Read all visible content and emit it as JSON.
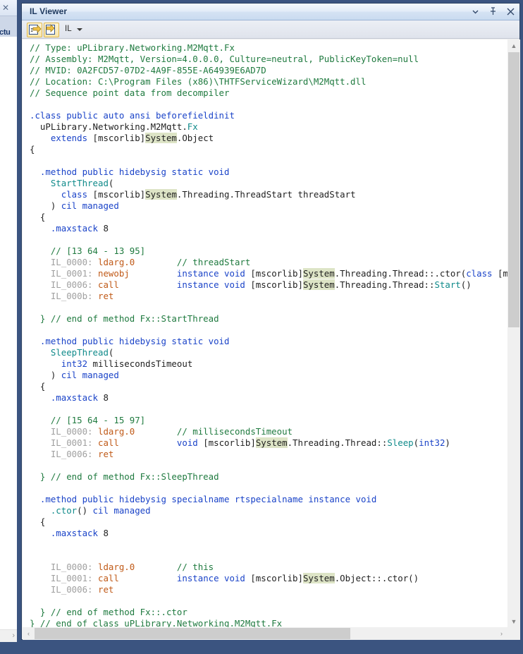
{
  "window": {
    "title": "IL Viewer",
    "buttons": [
      {
        "name": "window-dropdown-button",
        "icon": "chevron-down-icon"
      },
      {
        "name": "window-pin-button",
        "icon": "pin-icon"
      },
      {
        "name": "window-close-button",
        "icon": "close-icon"
      }
    ]
  },
  "background_panel": {
    "close_glyph": "✕",
    "tab_label": "ctu",
    "scroll_arrow": "›"
  },
  "toolbar": {
    "button1_name": "il-navigate-back-button",
    "button2_name": "il-navigate-forward-button",
    "language_label": "IL",
    "language_caret": "caret-down-icon"
  },
  "scrollbars": {
    "vertical": {
      "up": "▲",
      "down": "▼"
    },
    "horizontal": {
      "left": "‹",
      "right": "›"
    }
  },
  "code": {
    "language": "IL",
    "header_comments": [
      "// Type: uPLibrary.Networking.M2Mqtt.Fx",
      "// Assembly: M2Mqtt, Version=4.0.0.0, Culture=neutral, PublicKeyToken=null",
      "// MVID: 0A2FCD57-07D2-4A9F-855E-A64939E6AD7D",
      "// Location: C:\\Program Files (x86)\\THTFServiceWizard\\M2Mqtt.dll",
      "// Sequence point data from decompiler"
    ],
    "lines": [
      [
        {
          "t": "// Type: uPLibrary.Networking.M2Mqtt.Fx",
          "c": "c"
        }
      ],
      [
        {
          "t": "// Assembly: M2Mqtt, Version=4.0.0.0, Culture=neutral, PublicKeyToken=null",
          "c": "c"
        }
      ],
      [
        {
          "t": "// MVID: 0A2FCD57-07D2-4A9F-855E-A64939E6AD7D",
          "c": "c"
        }
      ],
      [
        {
          "t": "// Location: C:\\Program Files (x86)\\THTFServiceWizard\\M2Mqtt.dll",
          "c": "c"
        }
      ],
      [
        {
          "t": "// Sequence point data from decompiler",
          "c": "c"
        }
      ],
      [],
      [
        {
          "t": ".class public auto ansi beforefieldinit",
          "c": "kw"
        }
      ],
      [
        {
          "t": "  uPLibrary.Networking.M2Mqtt.",
          "c": "pl"
        },
        {
          "t": "Fx",
          "c": "ty"
        }
      ],
      [
        {
          "t": "    ",
          "c": "pl"
        },
        {
          "t": "extends",
          "c": "kw"
        },
        {
          "t": " [mscorlib]",
          "c": "pl"
        },
        {
          "t": "System",
          "c": "pl hl"
        },
        {
          "t": ".Object",
          "c": "pl"
        }
      ],
      [
        {
          "t": "{",
          "c": "pl"
        }
      ],
      [],
      [
        {
          "t": "  ",
          "c": "pl"
        },
        {
          "t": ".method public hidebysig static void",
          "c": "kw"
        }
      ],
      [
        {
          "t": "    ",
          "c": "pl"
        },
        {
          "t": "StartThread",
          "c": "ty"
        },
        {
          "t": "(",
          "c": "pl"
        }
      ],
      [
        {
          "t": "      ",
          "c": "pl"
        },
        {
          "t": "class",
          "c": "kw"
        },
        {
          "t": " [mscorlib]",
          "c": "pl"
        },
        {
          "t": "System",
          "c": "pl hl"
        },
        {
          "t": ".Threading.ThreadStart threadStart",
          "c": "pl"
        }
      ],
      [
        {
          "t": "    ) ",
          "c": "pl"
        },
        {
          "t": "cil managed",
          "c": "kw"
        }
      ],
      [
        {
          "t": "  {",
          "c": "pl"
        }
      ],
      [
        {
          "t": "    ",
          "c": "pl"
        },
        {
          "t": ".maxstack",
          "c": "kw"
        },
        {
          "t": " 8",
          "c": "pl"
        }
      ],
      [],
      [
        {
          "t": "    // [13 64 - 13 95]",
          "c": "c"
        }
      ],
      [
        {
          "t": "    ",
          "c": "pl"
        },
        {
          "t": "IL_0000:",
          "c": "lbl"
        },
        {
          "t": " ",
          "c": "pl"
        },
        {
          "t": "ldarg.0",
          "c": "op"
        },
        {
          "t": "        ",
          "c": "pl"
        },
        {
          "t": "// threadStart",
          "c": "c"
        }
      ],
      [
        {
          "t": "    ",
          "c": "pl"
        },
        {
          "t": "IL_0001:",
          "c": "lbl"
        },
        {
          "t": " ",
          "c": "pl"
        },
        {
          "t": "newobj",
          "c": "op"
        },
        {
          "t": "         ",
          "c": "pl"
        },
        {
          "t": "instance void",
          "c": "kw"
        },
        {
          "t": " [mscorlib]",
          "c": "pl"
        },
        {
          "t": "System",
          "c": "pl hl"
        },
        {
          "t": ".Threading.Thread::.ctor(",
          "c": "pl"
        },
        {
          "t": "class",
          "c": "kw"
        },
        {
          "t": " [mscorl",
          "c": "pl"
        }
      ],
      [
        {
          "t": "    ",
          "c": "pl"
        },
        {
          "t": "IL_0006:",
          "c": "lbl"
        },
        {
          "t": " ",
          "c": "pl"
        },
        {
          "t": "call",
          "c": "op"
        },
        {
          "t": "           ",
          "c": "pl"
        },
        {
          "t": "instance void",
          "c": "kw"
        },
        {
          "t": " [mscorlib]",
          "c": "pl"
        },
        {
          "t": "System",
          "c": "pl hl"
        },
        {
          "t": ".Threading.Thread::",
          "c": "pl"
        },
        {
          "t": "Start",
          "c": "ty"
        },
        {
          "t": "()",
          "c": "pl"
        }
      ],
      [
        {
          "t": "    ",
          "c": "pl"
        },
        {
          "t": "IL_000b:",
          "c": "lbl"
        },
        {
          "t": " ",
          "c": "pl"
        },
        {
          "t": "ret",
          "c": "op"
        }
      ],
      [],
      [
        {
          "t": "  } // end of method Fx::StartThread",
          "c": "c"
        }
      ],
      [],
      [
        {
          "t": "  ",
          "c": "pl"
        },
        {
          "t": ".method public hidebysig static void",
          "c": "kw"
        }
      ],
      [
        {
          "t": "    ",
          "c": "pl"
        },
        {
          "t": "SleepThread",
          "c": "ty"
        },
        {
          "t": "(",
          "c": "pl"
        }
      ],
      [
        {
          "t": "      ",
          "c": "pl"
        },
        {
          "t": "int32",
          "c": "kw"
        },
        {
          "t": " millisecondsTimeout",
          "c": "pl"
        }
      ],
      [
        {
          "t": "    ) ",
          "c": "pl"
        },
        {
          "t": "cil managed",
          "c": "kw"
        }
      ],
      [
        {
          "t": "  {",
          "c": "pl"
        }
      ],
      [
        {
          "t": "    ",
          "c": "pl"
        },
        {
          "t": ".maxstack",
          "c": "kw"
        },
        {
          "t": " 8",
          "c": "pl"
        }
      ],
      [],
      [
        {
          "t": "    // [15 64 - 15 97]",
          "c": "c"
        }
      ],
      [
        {
          "t": "    ",
          "c": "pl"
        },
        {
          "t": "IL_0000:",
          "c": "lbl"
        },
        {
          "t": " ",
          "c": "pl"
        },
        {
          "t": "ldarg.0",
          "c": "op"
        },
        {
          "t": "        ",
          "c": "pl"
        },
        {
          "t": "// millisecondsTimeout",
          "c": "c"
        }
      ],
      [
        {
          "t": "    ",
          "c": "pl"
        },
        {
          "t": "IL_0001:",
          "c": "lbl"
        },
        {
          "t": " ",
          "c": "pl"
        },
        {
          "t": "call",
          "c": "op"
        },
        {
          "t": "           ",
          "c": "pl"
        },
        {
          "t": "void",
          "c": "kw"
        },
        {
          "t": " [mscorlib]",
          "c": "pl"
        },
        {
          "t": "System",
          "c": "pl hl"
        },
        {
          "t": ".Threading.Thread::",
          "c": "pl"
        },
        {
          "t": "Sleep",
          "c": "ty"
        },
        {
          "t": "(",
          "c": "pl"
        },
        {
          "t": "int32",
          "c": "kw"
        },
        {
          "t": ")",
          "c": "pl"
        }
      ],
      [
        {
          "t": "    ",
          "c": "pl"
        },
        {
          "t": "IL_0006:",
          "c": "lbl"
        },
        {
          "t": " ",
          "c": "pl"
        },
        {
          "t": "ret",
          "c": "op"
        }
      ],
      [],
      [
        {
          "t": "  } // end of method Fx::SleepThread",
          "c": "c"
        }
      ],
      [],
      [
        {
          "t": "  ",
          "c": "pl"
        },
        {
          "t": ".method public hidebysig specialname rtspecialname instance void",
          "c": "kw"
        }
      ],
      [
        {
          "t": "    ",
          "c": "pl"
        },
        {
          "t": ".ctor",
          "c": "ty"
        },
        {
          "t": "() ",
          "c": "pl"
        },
        {
          "t": "cil managed",
          "c": "kw"
        }
      ],
      [
        {
          "t": "  {",
          "c": "pl"
        }
      ],
      [
        {
          "t": "    ",
          "c": "pl"
        },
        {
          "t": ".maxstack",
          "c": "kw"
        },
        {
          "t": " 8",
          "c": "pl"
        }
      ],
      [],
      [],
      [
        {
          "t": "    ",
          "c": "pl"
        },
        {
          "t": "IL_0000:",
          "c": "lbl"
        },
        {
          "t": " ",
          "c": "pl"
        },
        {
          "t": "ldarg.0",
          "c": "op"
        },
        {
          "t": "        ",
          "c": "pl"
        },
        {
          "t": "// this",
          "c": "c"
        }
      ],
      [
        {
          "t": "    ",
          "c": "pl"
        },
        {
          "t": "IL_0001:",
          "c": "lbl"
        },
        {
          "t": " ",
          "c": "pl"
        },
        {
          "t": "call",
          "c": "op"
        },
        {
          "t": "           ",
          "c": "pl"
        },
        {
          "t": "instance void",
          "c": "kw"
        },
        {
          "t": " [mscorlib]",
          "c": "pl"
        },
        {
          "t": "System",
          "c": "pl hl"
        },
        {
          "t": ".Object::.ctor()",
          "c": "pl"
        }
      ],
      [
        {
          "t": "    ",
          "c": "pl"
        },
        {
          "t": "IL_0006:",
          "c": "lbl"
        },
        {
          "t": " ",
          "c": "pl"
        },
        {
          "t": "ret",
          "c": "op"
        }
      ],
      [],
      [
        {
          "t": "  } // end of method Fx::.ctor",
          "c": "c"
        }
      ],
      [
        {
          "t": "} // end of class uPLibrary.Networking.M2Mqtt.Fx",
          "c": "c"
        }
      ]
    ]
  },
  "colors": {
    "comment": "#1f7a3f",
    "keyword": "#1a43c8",
    "type": "#0f8a8a",
    "opcode": "#c05a18",
    "il_label": "#a0a0a0",
    "highlight_bg": "#dde4c6",
    "window_chrome": "#3b5480",
    "editor_bg": "#ffffff"
  }
}
